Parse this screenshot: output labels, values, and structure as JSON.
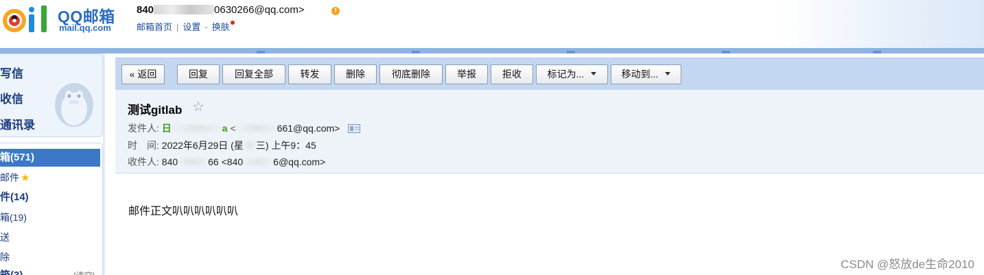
{
  "header": {
    "logo_title": "QQ邮箱",
    "logo_domain": "mail.qq.com",
    "account_prefix": "840",
    "account_email": "0630266@qq.com>",
    "links": [
      "邮箱首页",
      "设置",
      "换肤"
    ],
    "separator": "|",
    "dash": "-"
  },
  "sidebar": {
    "actions": [
      "写信",
      "收信",
      "通讯录"
    ],
    "folders": [
      {
        "label": "箱(571)",
        "bold": true,
        "active": true
      },
      {
        "label": "邮件",
        "star": true
      },
      {
        "label": "件(14)",
        "bold": true
      },
      {
        "label": "箱(19)"
      },
      {
        "label": "送"
      },
      {
        "label": "除"
      },
      {
        "label": "箱(3)",
        "bold": true,
        "clear": "[清空]"
      }
    ]
  },
  "toolbar": {
    "buttons": [
      "« 返回",
      "回复",
      "回复全部",
      "转发",
      "删除",
      "彻底删除",
      "举报",
      "拒收"
    ],
    "dropdowns": [
      "标记为...",
      "移动到..."
    ]
  },
  "mail": {
    "subject": "测试gitlab",
    "star_icon": "☆",
    "from_label": "发件人:",
    "from_name_start": "日",
    "from_name_end": "a",
    "from_lt": "<",
    "from_email_end": "661@qq.com>",
    "time_label": "时　间:",
    "time_value_a": "2022年6月29日 (星",
    "time_value_b": "三) 上午9：45",
    "to_label": "收件人:",
    "to_name_start": "840",
    "to_name_end": "66",
    "to_email_start": "<840",
    "to_email_end": "6@qq.com>",
    "body": "邮件正文叭叭叭叭叭叭"
  },
  "watermark": "CSDN @怒放de生命2010",
  "colors": {
    "brand_blue": "#2a6bc4",
    "toolbar_bg": "#c4d7f0",
    "sender_green": "#3c9a1f",
    "active_folder": "#3d78c8"
  }
}
